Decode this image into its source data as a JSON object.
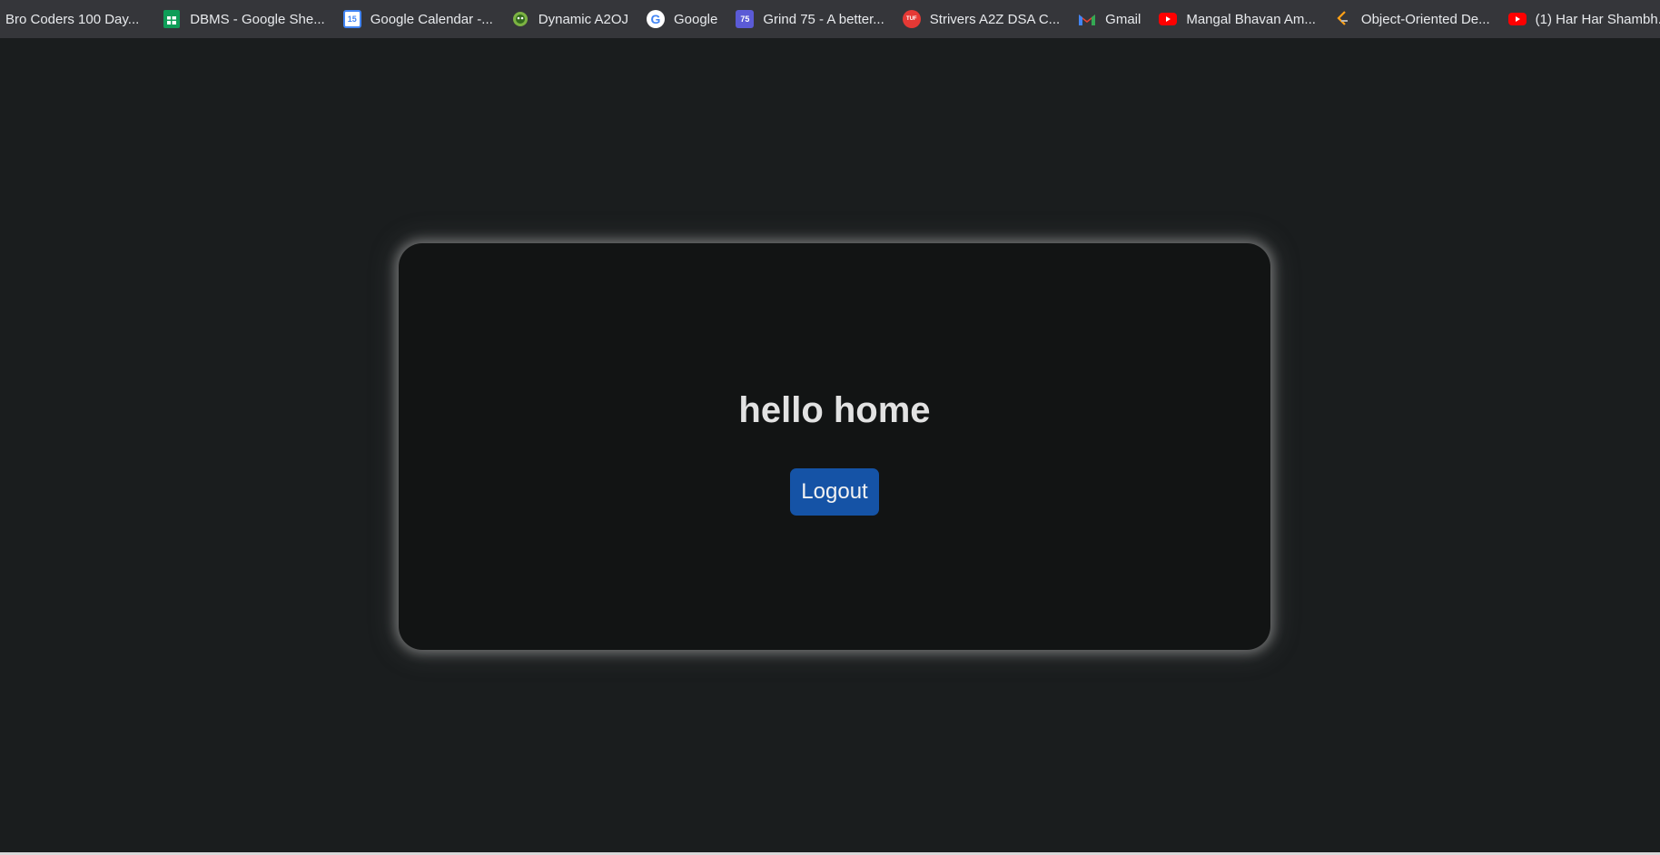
{
  "bookmarks": [
    {
      "label": "Bro Coders 100 Day...",
      "icon": "none"
    },
    {
      "label": "DBMS - Google She...",
      "icon": "google-sheets-icon",
      "color": "#0f9d58"
    },
    {
      "label": "Google Calendar -...",
      "icon": "google-calendar-icon",
      "color": "#4285f4",
      "text": "15"
    },
    {
      "label": "Dynamic A2OJ",
      "icon": "a2oj-icon",
      "color": "#7cb342"
    },
    {
      "label": "Google",
      "icon": "google-icon",
      "color": "#ffffff",
      "text": "G"
    },
    {
      "label": "Grind 75 - A better...",
      "icon": "grind75-icon",
      "color": "#5b5bd6",
      "text": "75"
    },
    {
      "label": "Strivers A2Z DSA C...",
      "icon": "takeuforward-icon",
      "color": "#e53935",
      "text": "TUF"
    },
    {
      "label": "Gmail",
      "icon": "gmail-icon",
      "color": "#ea4335",
      "text": "M"
    },
    {
      "label": "Mangal Bhavan Am...",
      "icon": "youtube-icon",
      "color": "#ff0000"
    },
    {
      "label": "Object-Oriented De...",
      "icon": "leetcode-icon",
      "color": "#ffa116"
    },
    {
      "label": "(1) Har Har Shambh...",
      "icon": "youtube-icon",
      "color": "#ff0000"
    }
  ],
  "card": {
    "title": "hello home",
    "logout_label": "Logout",
    "accent": "#1553a6"
  }
}
